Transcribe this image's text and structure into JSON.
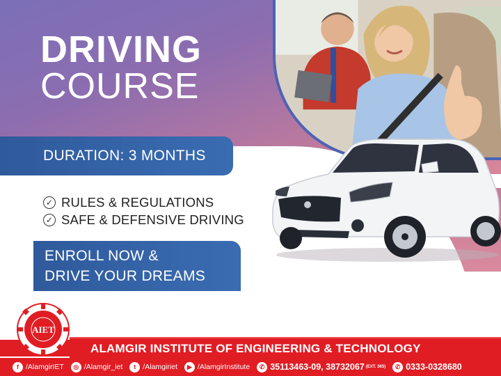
{
  "title": {
    "line1": "DRIVING",
    "line2": "COURSE"
  },
  "duration": "DURATION: 3 MONTHS",
  "bullets": [
    "RULES & REGULATIONS",
    "SAFE & DEFENSIVE DRIVING"
  ],
  "enroll": {
    "line1": "ENROLL NOW &",
    "line2": "DRIVE YOUR DREAMS"
  },
  "logo": {
    "text": "AIET"
  },
  "institute": "ALAMGIR INSTITUTE OF ENGINEERING & TECHNOLOGY",
  "contacts": {
    "facebook": "/AlamgirIET",
    "instagram": "/Alamgir_iet",
    "twitter": "/Alamgiriet",
    "youtube": "/AlamgirInstitute",
    "phone": "35113463-09, 38732067",
    "phone_ext": "(EXT. 365)",
    "whatsapp": "0333-0328680"
  },
  "icons": {
    "facebook": "facebook-icon",
    "instagram": "instagram-icon",
    "twitter": "twitter-icon",
    "youtube": "youtube-icon",
    "phone": "phone-icon",
    "whatsapp": "whatsapp-icon",
    "check": "check-circle-icon"
  },
  "colors": {
    "brand_red": "#e11d24",
    "banner_blue": "#2f5a9c",
    "gradient_purple": "#7b6fb8",
    "gradient_pink": "#d8869a"
  }
}
